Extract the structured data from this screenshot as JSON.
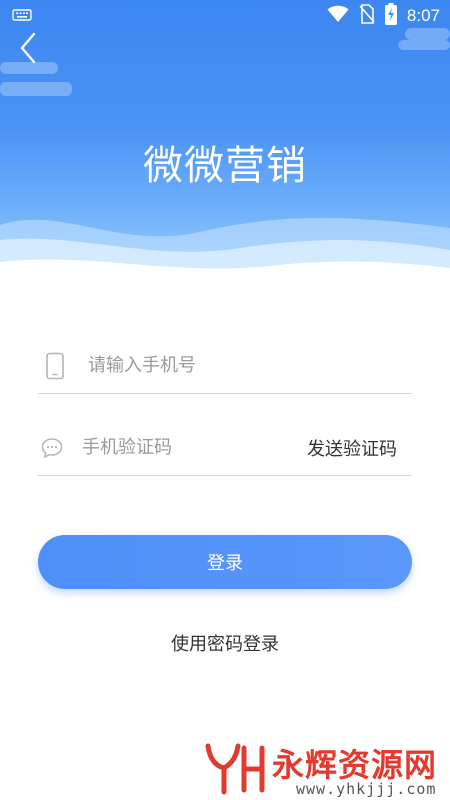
{
  "status_bar": {
    "time": "8:07",
    "icons": [
      "keyboard-icon",
      "wifi-icon",
      "no-sim-icon",
      "battery-charging-icon"
    ]
  },
  "header": {
    "back_icon": "chevron-left-icon",
    "app_title": "微微营销"
  },
  "form": {
    "phone": {
      "icon": "phone-icon",
      "placeholder": "请输入手机号",
      "value": ""
    },
    "code": {
      "icon": "chat-bubble-icon",
      "placeholder": "手机验证码",
      "value": "",
      "send_code_label": "发送验证码"
    },
    "login_label": "登录",
    "password_login_label": "使用密码登录"
  },
  "watermark": {
    "text": "永辉资源网",
    "url": "www.yhkjjj.com"
  },
  "colors": {
    "header_top": "#3c86f1",
    "header_bottom": "#9fcdfd",
    "button": "#5b97fb",
    "text": "#333333",
    "placeholder": "#9a9a9a",
    "divider": "#d7d7d7",
    "watermark": "#e23a2e"
  }
}
